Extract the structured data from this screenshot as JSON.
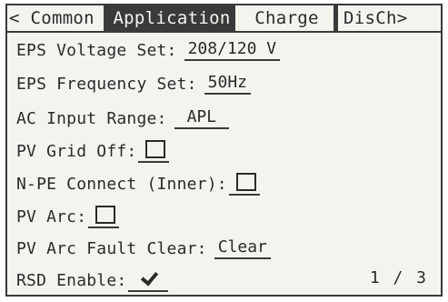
{
  "tabs": [
    {
      "label": "< Common"
    },
    {
      "label": "Application"
    },
    {
      "label": "Charge"
    },
    {
      "label": "DisCh>"
    }
  ],
  "settings": {
    "eps_voltage": {
      "label": "EPS Voltage Set:",
      "value": "208/120 V"
    },
    "eps_frequency": {
      "label": "EPS Frequency Set:",
      "value": "50Hz"
    },
    "ac_input_range": {
      "label": "AC Input Range:",
      "value": "APL"
    },
    "pv_grid_off": {
      "label": "PV Grid Off:",
      "checked": false
    },
    "npe_connect": {
      "label": "N-PE Connect (Inner):",
      "checked": false
    },
    "pv_arc": {
      "label": "PV Arc:",
      "checked": false
    },
    "pv_arc_fault_clear": {
      "label": "PV Arc Fault Clear:",
      "value": "Clear"
    },
    "rsd_enable": {
      "label": "RSD Enable:",
      "checked": true
    }
  },
  "pagination": {
    "text": "1 / 3"
  }
}
